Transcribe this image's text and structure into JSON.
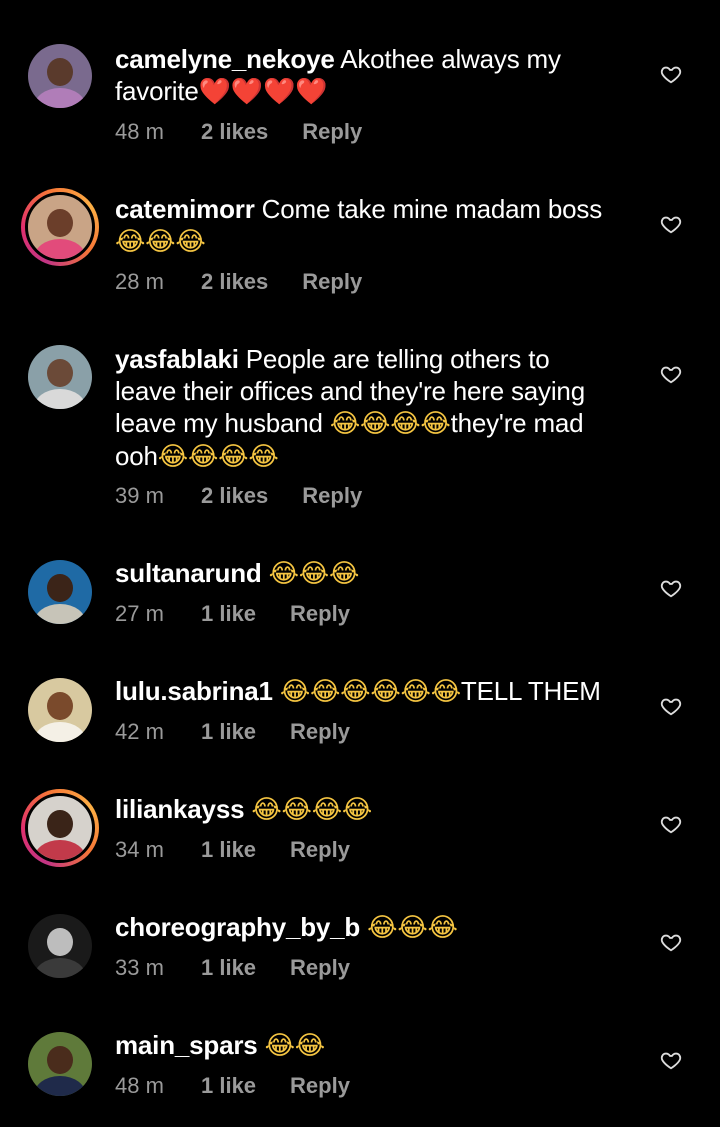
{
  "comments": [
    {
      "username": "camelyne_nekoye",
      "text": "Akothee always my favorite",
      "emojis": "❤️❤️❤️❤️",
      "time": "48 m",
      "likes": "2 likes",
      "reply": "Reply",
      "story_ring": false,
      "avatar_colors": {
        "bg": "#7a6a8e",
        "face": "#5a3a2c",
        "body": "#b07db8"
      }
    },
    {
      "username": "catemimorr",
      "text": "Come take mine madam boss",
      "emojis": "😂😂😂",
      "time": "28 m",
      "likes": "2 likes",
      "reply": "Reply",
      "story_ring": true,
      "avatar_colors": {
        "bg": "#c9a486",
        "face": "#6b3e2a",
        "body": "#e24b7b"
      }
    },
    {
      "username": "yasfablaki",
      "text_lines": [
        "People are telling others to",
        "leave their offices and they're here saying",
        "leave my husband ",
        "they're mad",
        "ooh"
      ],
      "emojis_a": "😂😂😂😂",
      "emojis_b": "😂😂😂😂",
      "time": "39 m",
      "likes": "2 likes",
      "reply": "Reply",
      "story_ring": false,
      "avatar_colors": {
        "bg": "#8aa0a8",
        "face": "#6b4a38",
        "body": "#d9d9d9"
      }
    },
    {
      "username": "sultanarund",
      "emojis": "😂😂😂",
      "time": "27 m",
      "likes": "1 like",
      "reply": "Reply",
      "story_ring": false,
      "avatar_colors": {
        "bg": "#1f6aa5",
        "face": "#3b2418",
        "body": "#c7c4b8"
      }
    },
    {
      "username": "lulu.sabrina1",
      "text": "TELL THEM",
      "emojis": "😂😂😂😂😂😂",
      "time": "42 m",
      "likes": "1 like",
      "reply": "Reply",
      "story_ring": false,
      "avatar_colors": {
        "bg": "#d8c9a0",
        "face": "#7a4a2c",
        "body": "#f4f0e6"
      }
    },
    {
      "username": "liliankayss",
      "emojis": "😂😂😂😂",
      "time": "34 m",
      "likes": "1 like",
      "reply": "Reply",
      "story_ring": true,
      "avatar_colors": {
        "bg": "#d6d2cc",
        "face": "#3a2418",
        "body": "#c23a4a"
      }
    },
    {
      "username": "choreography_by_b",
      "emojis": "😂😂😂",
      "time": "33 m",
      "likes": "1 like",
      "reply": "Reply",
      "story_ring": false,
      "avatar_colors": {
        "bg": "#1a1a1a",
        "face": "#bdbdbd",
        "body": "#3a3a3a"
      }
    },
    {
      "username": "main_spars",
      "emojis": "😂😂",
      "time": "48 m",
      "likes": "1 like",
      "reply": "Reply",
      "story_ring": false,
      "avatar_colors": {
        "bg": "#5f7a3a",
        "face": "#4a2c1c",
        "body": "#1f2a4a"
      }
    }
  ],
  "colors": {
    "background": "#000000",
    "text": "#ffffff",
    "meta": "#9a9a9a"
  },
  "icons": {
    "like": "heart-outline-icon"
  }
}
